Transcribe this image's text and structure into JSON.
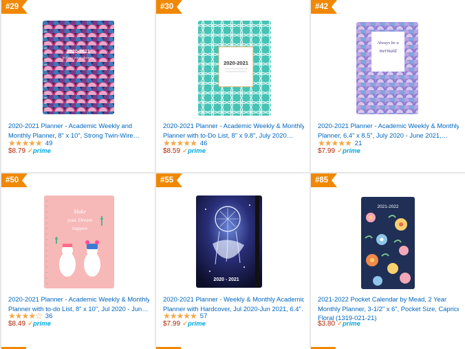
{
  "products": [
    {
      "rank": "#29",
      "title1": "2020-2021 Planner - Academic Weekly and",
      "title2": "Monthly Planner, 8\" x 10\", Strong Twin-Wire…",
      "rating_count": "49",
      "price": "$8.79",
      "stars": "★★★★★",
      "cover_text": "2020-2021 follow your dreams"
    },
    {
      "rank": "#30",
      "title1": "2020-2021 Planner - Academic Weekly & Monthly",
      "title2": "Planner with to-Do List, 8\" x 9.8\", July 2020…",
      "rating_count": "46",
      "price": "$8.59",
      "stars": "★★★★★",
      "cover_text": "2020-2021"
    },
    {
      "rank": "#42",
      "title1": "2020-2021 Planner - Academic Weekly & Monthly",
      "title2": "Planner, 6.4\" x 8.5\", July 2020 - June 2021,…",
      "rating_count": "21",
      "price": "$7.99",
      "stars": "★★★★★",
      "cover_text": "Always be a mermaid"
    },
    {
      "rank": "#50",
      "title1": "2020-2021 Planner - Academic Weekly & Monthly",
      "title2": "Planner with to-do List, 8\" x 10\", Jul 2020 - Jun…",
      "rating_count": "36",
      "price": "$8.49",
      "stars": "★★★★☆",
      "cover_text": "Make your Dream happen"
    },
    {
      "rank": "#55",
      "title1": "2020-2021 Planner - Weekly & Monthly Academic",
      "title2": "Planner with Hardcover, Jul 2020-Jun 2021, 6.4\"…",
      "rating_count": "57",
      "price": "$7.99",
      "stars": "★★★★★",
      "cover_text": "2020 - 2021"
    },
    {
      "rank": "#85",
      "title1": "2021-2022 Pocket Calendar by Mead, 2 Year",
      "title2": "Monthly Planner, 3-1/2\" x 6\", Pocket Size, Caprice",
      "title3": "Floral (1319-021-21)",
      "price": "$3.80",
      "cover_text": "2021-2022"
    }
  ],
  "prime_label": "prime",
  "prime_check": "✓",
  "colors": {
    "badge": "#f08804",
    "link": "#0066c0",
    "price": "#b12704",
    "star": "#f3a847",
    "prime": "#00a8e1"
  }
}
